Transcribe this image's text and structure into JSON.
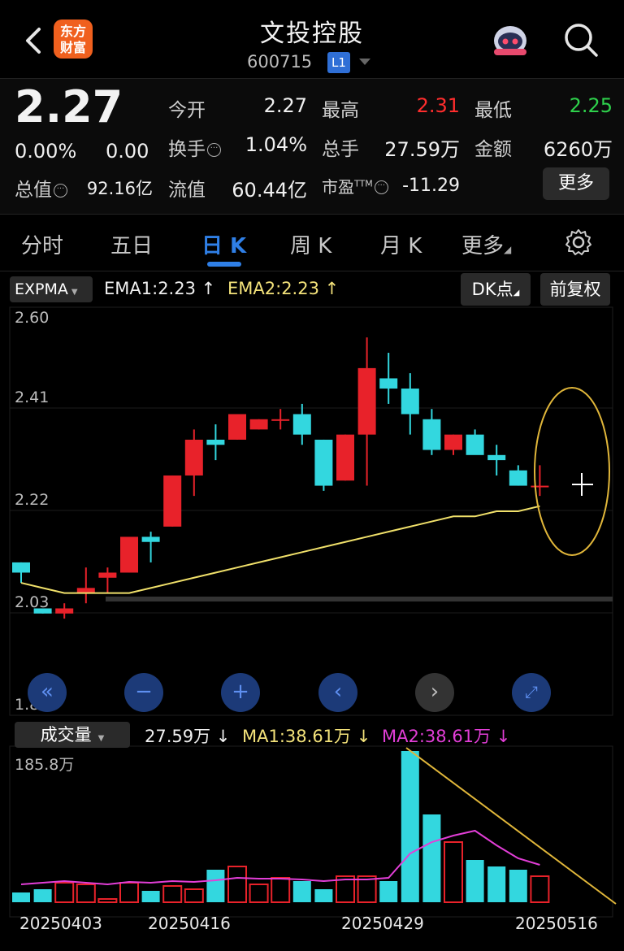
{
  "header": {
    "title": "文投控股",
    "code": "600715",
    "level_badge": "L1",
    "logo_text": [
      "东方",
      "财富"
    ],
    "back_icon": "chevron-left-icon",
    "assistant_icon": "robot-avatar-icon",
    "search_icon": "search-icon"
  },
  "quote": {
    "price": "2.27",
    "change_pct": "0.00%",
    "change": "0.00",
    "fields": {
      "open_label": "今开",
      "open_value": "2.27",
      "high_label": "最高",
      "high_value": "2.31",
      "low_label": "最低",
      "low_value": "2.25",
      "turnover_label": "换手",
      "turnover_value": "1.04%",
      "volume_label": "总手",
      "volume_value": "27.59万",
      "amount_label": "金额",
      "amount_value": "6260万",
      "mktcap_label": "总值",
      "mktcap_value": "92.16亿",
      "float_label": "流值",
      "float_value": "60.44亿",
      "pe_label": "市盈",
      "pe_sup": "TTM",
      "pe_value": "-11.29"
    },
    "more_button": "更多",
    "colors": {
      "up": "#ff2d2d",
      "down": "#2ed04b"
    }
  },
  "tabs": [
    {
      "label": "分时",
      "active": false
    },
    {
      "label": "五日",
      "active": false
    },
    {
      "label": "日 K",
      "active": true
    },
    {
      "label": "周 K",
      "active": false
    },
    {
      "label": "月 K",
      "active": false
    },
    {
      "label": "更多",
      "active": false
    }
  ],
  "settings_icon": "gear-icon",
  "indicator": {
    "name": "EXPMA",
    "ema1": "EMA1:2.23",
    "ema2": "EMA2:2.23",
    "dk_button": "DK点",
    "adjust_button": "前复权"
  },
  "volume_indicator": {
    "name": "成交量",
    "vol": "27.59万",
    "ma1": "MA1:38.61万",
    "ma2": "MA2:38.61万",
    "top_label": "185.8万"
  },
  "nav_buttons": [
    "double-chevron-left-icon",
    "minus-icon",
    "plus-icon",
    "chevron-left-icon",
    "chevron-right-icon",
    "expand-icon"
  ],
  "chart_data": {
    "type": "candlestick",
    "price_axis": {
      "labels": [
        "2.60",
        "2.41",
        "2.22",
        "2.03",
        "1.84"
      ],
      "ylim": [
        1.84,
        2.6
      ]
    },
    "dates": [
      "20250403",
      "20250416",
      "20250429",
      "20250516"
    ],
    "candles": [
      {
        "o": 2.12,
        "h": 2.12,
        "l": 2.08,
        "c": 2.1
      },
      {
        "o": 2.03,
        "h": 2.03,
        "l": 2.02,
        "c": 2.02
      },
      {
        "o": 2.02,
        "h": 2.04,
        "l": 2.01,
        "c": 2.03
      },
      {
        "o": 2.06,
        "h": 2.11,
        "l": 2.04,
        "c": 2.07
      },
      {
        "o": 2.09,
        "h": 2.11,
        "l": 2.06,
        "c": 2.1
      },
      {
        "o": 2.1,
        "h": 2.16,
        "l": 2.1,
        "c": 2.17
      },
      {
        "o": 2.17,
        "h": 2.18,
        "l": 2.12,
        "c": 2.16
      },
      {
        "o": 2.19,
        "h": 2.29,
        "l": 2.19,
        "c": 2.29
      },
      {
        "o": 2.29,
        "h": 2.38,
        "l": 2.25,
        "c": 2.36
      },
      {
        "o": 2.36,
        "h": 2.39,
        "l": 2.32,
        "c": 2.35
      },
      {
        "o": 2.36,
        "h": 2.4,
        "l": 2.36,
        "c": 2.41
      },
      {
        "o": 2.38,
        "h": 2.4,
        "l": 2.38,
        "c": 2.4
      },
      {
        "o": 2.4,
        "h": 2.42,
        "l": 2.38,
        "c": 2.4
      },
      {
        "o": 2.41,
        "h": 2.43,
        "l": 2.35,
        "c": 2.37
      },
      {
        "o": 2.36,
        "h": 2.36,
        "l": 2.26,
        "c": 2.27
      },
      {
        "o": 2.28,
        "h": 2.37,
        "l": 2.28,
        "c": 2.37
      },
      {
        "o": 2.37,
        "h": 2.56,
        "l": 2.27,
        "c": 2.5
      },
      {
        "o": 2.48,
        "h": 2.53,
        "l": 2.43,
        "c": 2.46
      },
      {
        "o": 2.46,
        "h": 2.49,
        "l": 2.37,
        "c": 2.41
      },
      {
        "o": 2.4,
        "h": 2.42,
        "l": 2.33,
        "c": 2.34
      },
      {
        "o": 2.34,
        "h": 2.37,
        "l": 2.33,
        "c": 2.37
      },
      {
        "o": 2.37,
        "h": 2.38,
        "l": 2.34,
        "c": 2.33
      },
      {
        "o": 2.33,
        "h": 2.35,
        "l": 2.29,
        "c": 2.32
      },
      {
        "o": 2.3,
        "h": 2.31,
        "l": 2.27,
        "c": 2.27
      },
      {
        "o": 2.27,
        "h": 2.31,
        "l": 2.25,
        "c": 2.27
      }
    ],
    "ema": [
      2.08,
      2.07,
      2.06,
      2.06,
      2.06,
      2.06,
      2.07,
      2.08,
      2.09,
      2.1,
      2.11,
      2.12,
      2.13,
      2.14,
      2.15,
      2.16,
      2.17,
      2.18,
      2.19,
      2.2,
      2.21,
      2.21,
      2.22,
      2.22,
      2.23
    ],
    "volumes": [
      12,
      16,
      24,
      22,
      4,
      24,
      14,
      20,
      16,
      40,
      44,
      22,
      30,
      26,
      16,
      32,
      32,
      26,
      186,
      108,
      74,
      52,
      44,
      40,
      32
    ],
    "volume_ma": [
      22,
      24,
      26,
      24,
      22,
      25,
      24,
      26,
      25,
      27,
      30,
      29,
      29,
      28,
      26,
      28,
      28,
      30,
      60,
      74,
      82,
      88,
      70,
      54,
      46
    ],
    "vol_ylim": [
      0,
      186
    ]
  }
}
